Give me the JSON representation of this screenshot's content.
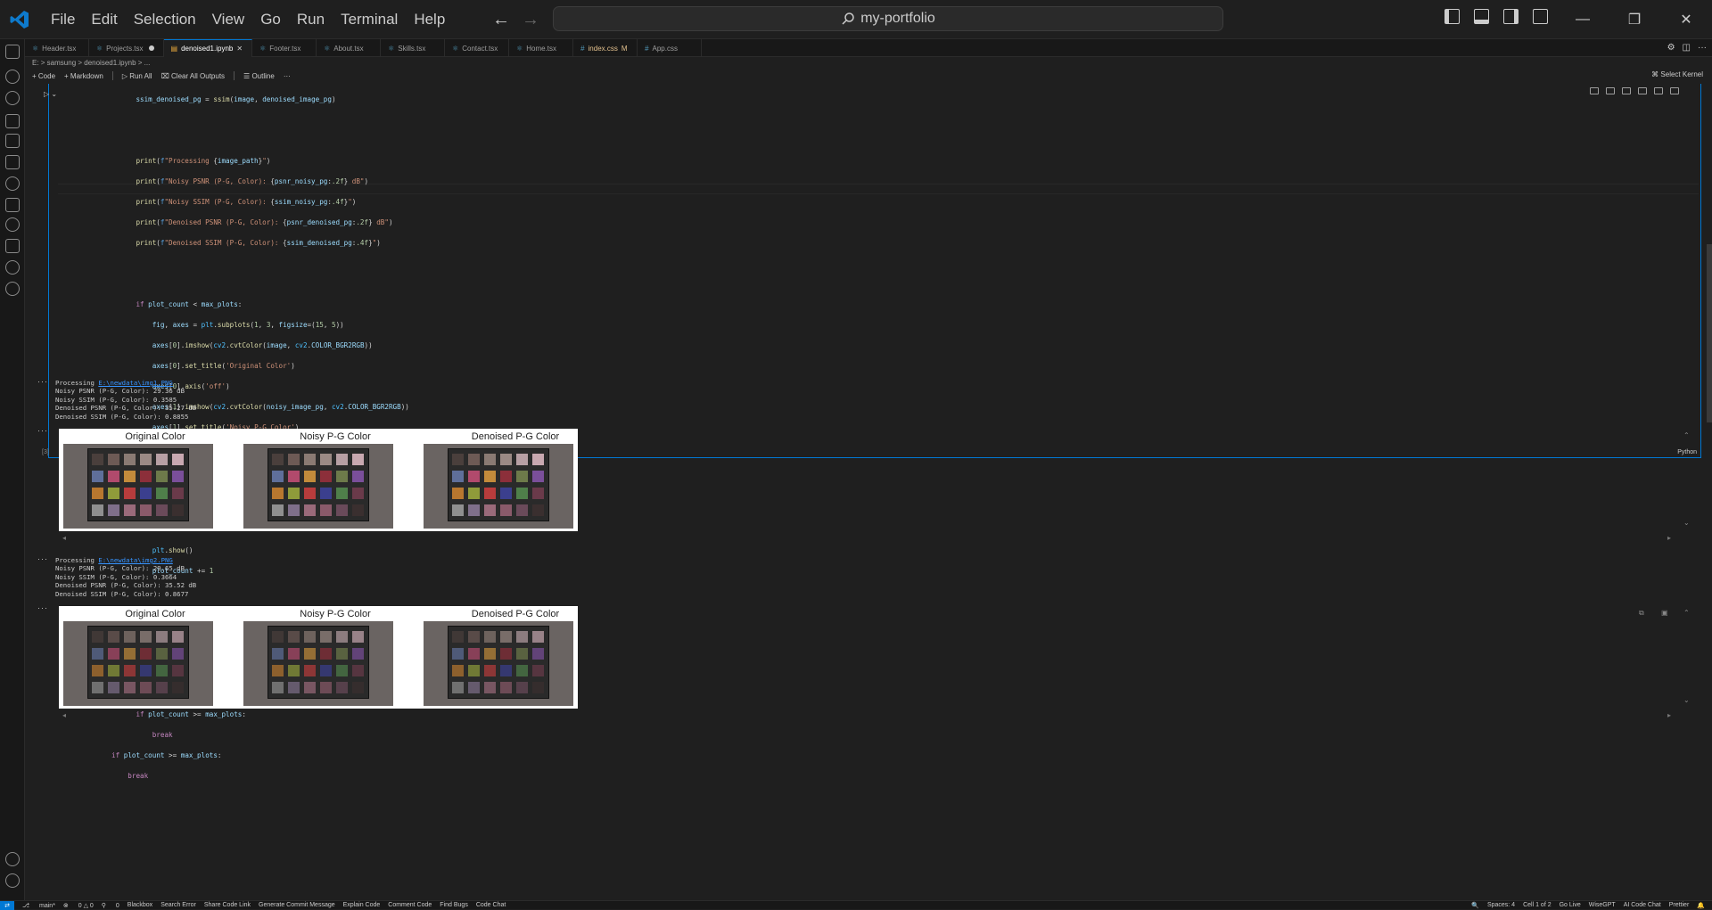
{
  "menu": [
    "File",
    "Edit",
    "Selection",
    "View",
    "Go",
    "Run",
    "Terminal",
    "Help"
  ],
  "search": {
    "text": "my-portfolio"
  },
  "tabs": [
    {
      "label": "Header.tsx",
      "icon": "react-icon",
      "state": ""
    },
    {
      "label": "Projects.tsx",
      "icon": "react-icon",
      "state": "dot"
    },
    {
      "label": "denoised1.ipynb",
      "icon": "notebook-icon",
      "state": "active"
    },
    {
      "label": "Footer.tsx",
      "icon": "react-icon",
      "state": ""
    },
    {
      "label": "About.tsx",
      "icon": "react-icon",
      "state": ""
    },
    {
      "label": "Skills.tsx",
      "icon": "react-icon",
      "state": ""
    },
    {
      "label": "Contact.tsx",
      "icon": "react-icon",
      "state": ""
    },
    {
      "label": "Home.tsx",
      "icon": "react-icon",
      "state": ""
    },
    {
      "label": "index.css",
      "icon": "hash-icon",
      "state": "modified",
      "badge": "M"
    },
    {
      "label": "App.css",
      "icon": "hash-icon",
      "state": ""
    }
  ],
  "breadcrumb": {
    "text": "E: > samsung > denoised1.ipynb > ..."
  },
  "notebook_toolbar": {
    "code": "+ Code",
    "markdown": "+ Markdown",
    "run_all": "Run All",
    "clear": "Clear All Outputs",
    "outline": "Outline",
    "more": "···",
    "kernel": "Select Kernel"
  },
  "cell": {
    "exec_count": "[3]",
    "language": "Python"
  },
  "outputs": [
    {
      "processing_prefix": "Processing ",
      "path": "E:\\newdata\\img1.PNG",
      "lines": [
        "Noisy PSNR (P-G, Color): 29.36 dB",
        "Noisy SSIM (P-G, Color): 0.3585",
        "Denoised PSNR (P-G, Color): 35.27 dB",
        "Denoised SSIM (P-G, Color): 0.8855"
      ]
    },
    {
      "processing_prefix": "Processing ",
      "path": "E:\\newdata\\img2.PNG",
      "lines": [
        "Noisy PSNR (P-G, Color): 29.65 dB",
        "Noisy SSIM (P-G, Color): 0.3664",
        "Denoised PSNR (P-G, Color): 35.52 dB",
        "Denoised SSIM (P-G, Color): 0.8677"
      ]
    }
  ],
  "figure_titles": [
    "Original Color",
    "Noisy P-G Color",
    "Denoised P-G Color"
  ],
  "patch_colors": [
    "#4a3f3c",
    "#6d5a55",
    "#8a7a73",
    "#9b8a85",
    "#b79fa4",
    "#c8a8b0",
    "#5f6f9a",
    "#b14a6c",
    "#c28b3b",
    "#8c2f3a",
    "#6d7a4a",
    "#7a4f9a",
    "#b8772f",
    "#8f9b3a",
    "#b83c3c",
    "#3b3f8e",
    "#4f7f4a",
    "#6a3a4a",
    "#8f8f8f",
    "#7f6f8a",
    "#9a6a7a",
    "#8a5a6a",
    "#6a4a5a",
    "#3a2f2f"
  ],
  "status": {
    "branch": "main*",
    "problems": "0 △ 0",
    "ports": "0",
    "items": [
      "Blackbox",
      "Search Error",
      "Share Code Link",
      "Generate Commit Message",
      "Explain Code",
      "Comment Code",
      "Find Bugs",
      "Code Chat"
    ],
    "right": [
      "Spaces: 4",
      "Cell 1 of 2",
      "Go Live",
      "WiseGPT",
      "AI Code Chat",
      "Prettier"
    ]
  }
}
